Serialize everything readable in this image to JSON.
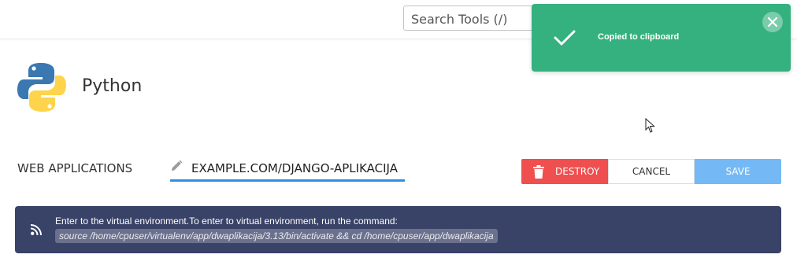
{
  "header": {
    "search": {
      "placeholder": "Search Tools (/)"
    }
  },
  "toast": {
    "message": "Copied to clipboard",
    "icon": "check-icon",
    "close_icon": "close-icon",
    "color": "#34b17e"
  },
  "app": {
    "title": "Python",
    "logo_icon": "python-logo"
  },
  "breadcrumb": {
    "root": "WEB APPLICATIONS",
    "current": "EXAMPLE.COM/DJANGO-APLIKACIJA"
  },
  "actions": {
    "destroy": "DESTROY",
    "cancel": "CANCEL",
    "save": "SAVE",
    "colors": {
      "destroy": "#ef4f4f",
      "save": "#74b9f5",
      "accent": "#2f8fe0"
    }
  },
  "info": {
    "text": "Enter to the virtual environment.To enter to virtual environment, run the command:",
    "command": "source /home/cpuser/virtualenv/app/dwaplikacija/3.13/bin/activate && cd /home/cpuser/app/dwaplikacija",
    "icon": "rss-icon",
    "color": "#394267"
  }
}
